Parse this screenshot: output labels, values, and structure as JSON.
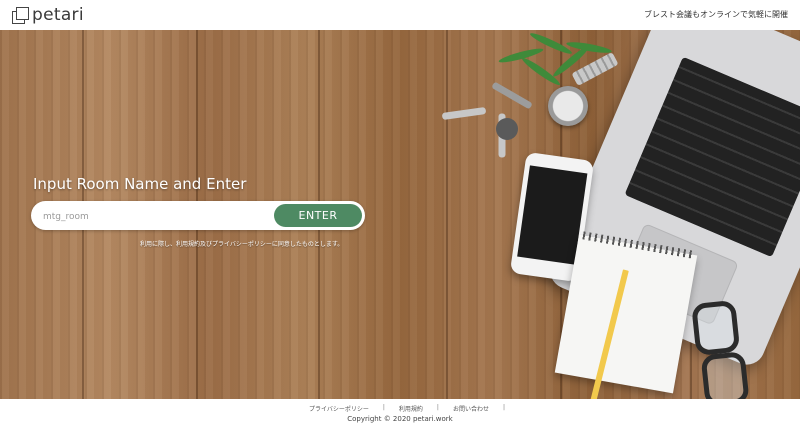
{
  "header": {
    "logo_text": "petari",
    "tagline": "ブレスト会議もオンラインで気軽に開催"
  },
  "hero": {
    "headline": "Input Room Name and Enter",
    "room_input": {
      "placeholder": "mtg_room",
      "value": ""
    },
    "enter_label": "ENTER",
    "notice": "利用に際し、利用規約及びプライバシーポリシーに同意したものとします。",
    "accent_color": "#4e8a63"
  },
  "footer": {
    "links": [
      "プライバシーポリシー",
      "利用規約",
      "お問い合わせ"
    ],
    "separator": "|",
    "copyright": "Copyright © 2020 petari.work"
  }
}
